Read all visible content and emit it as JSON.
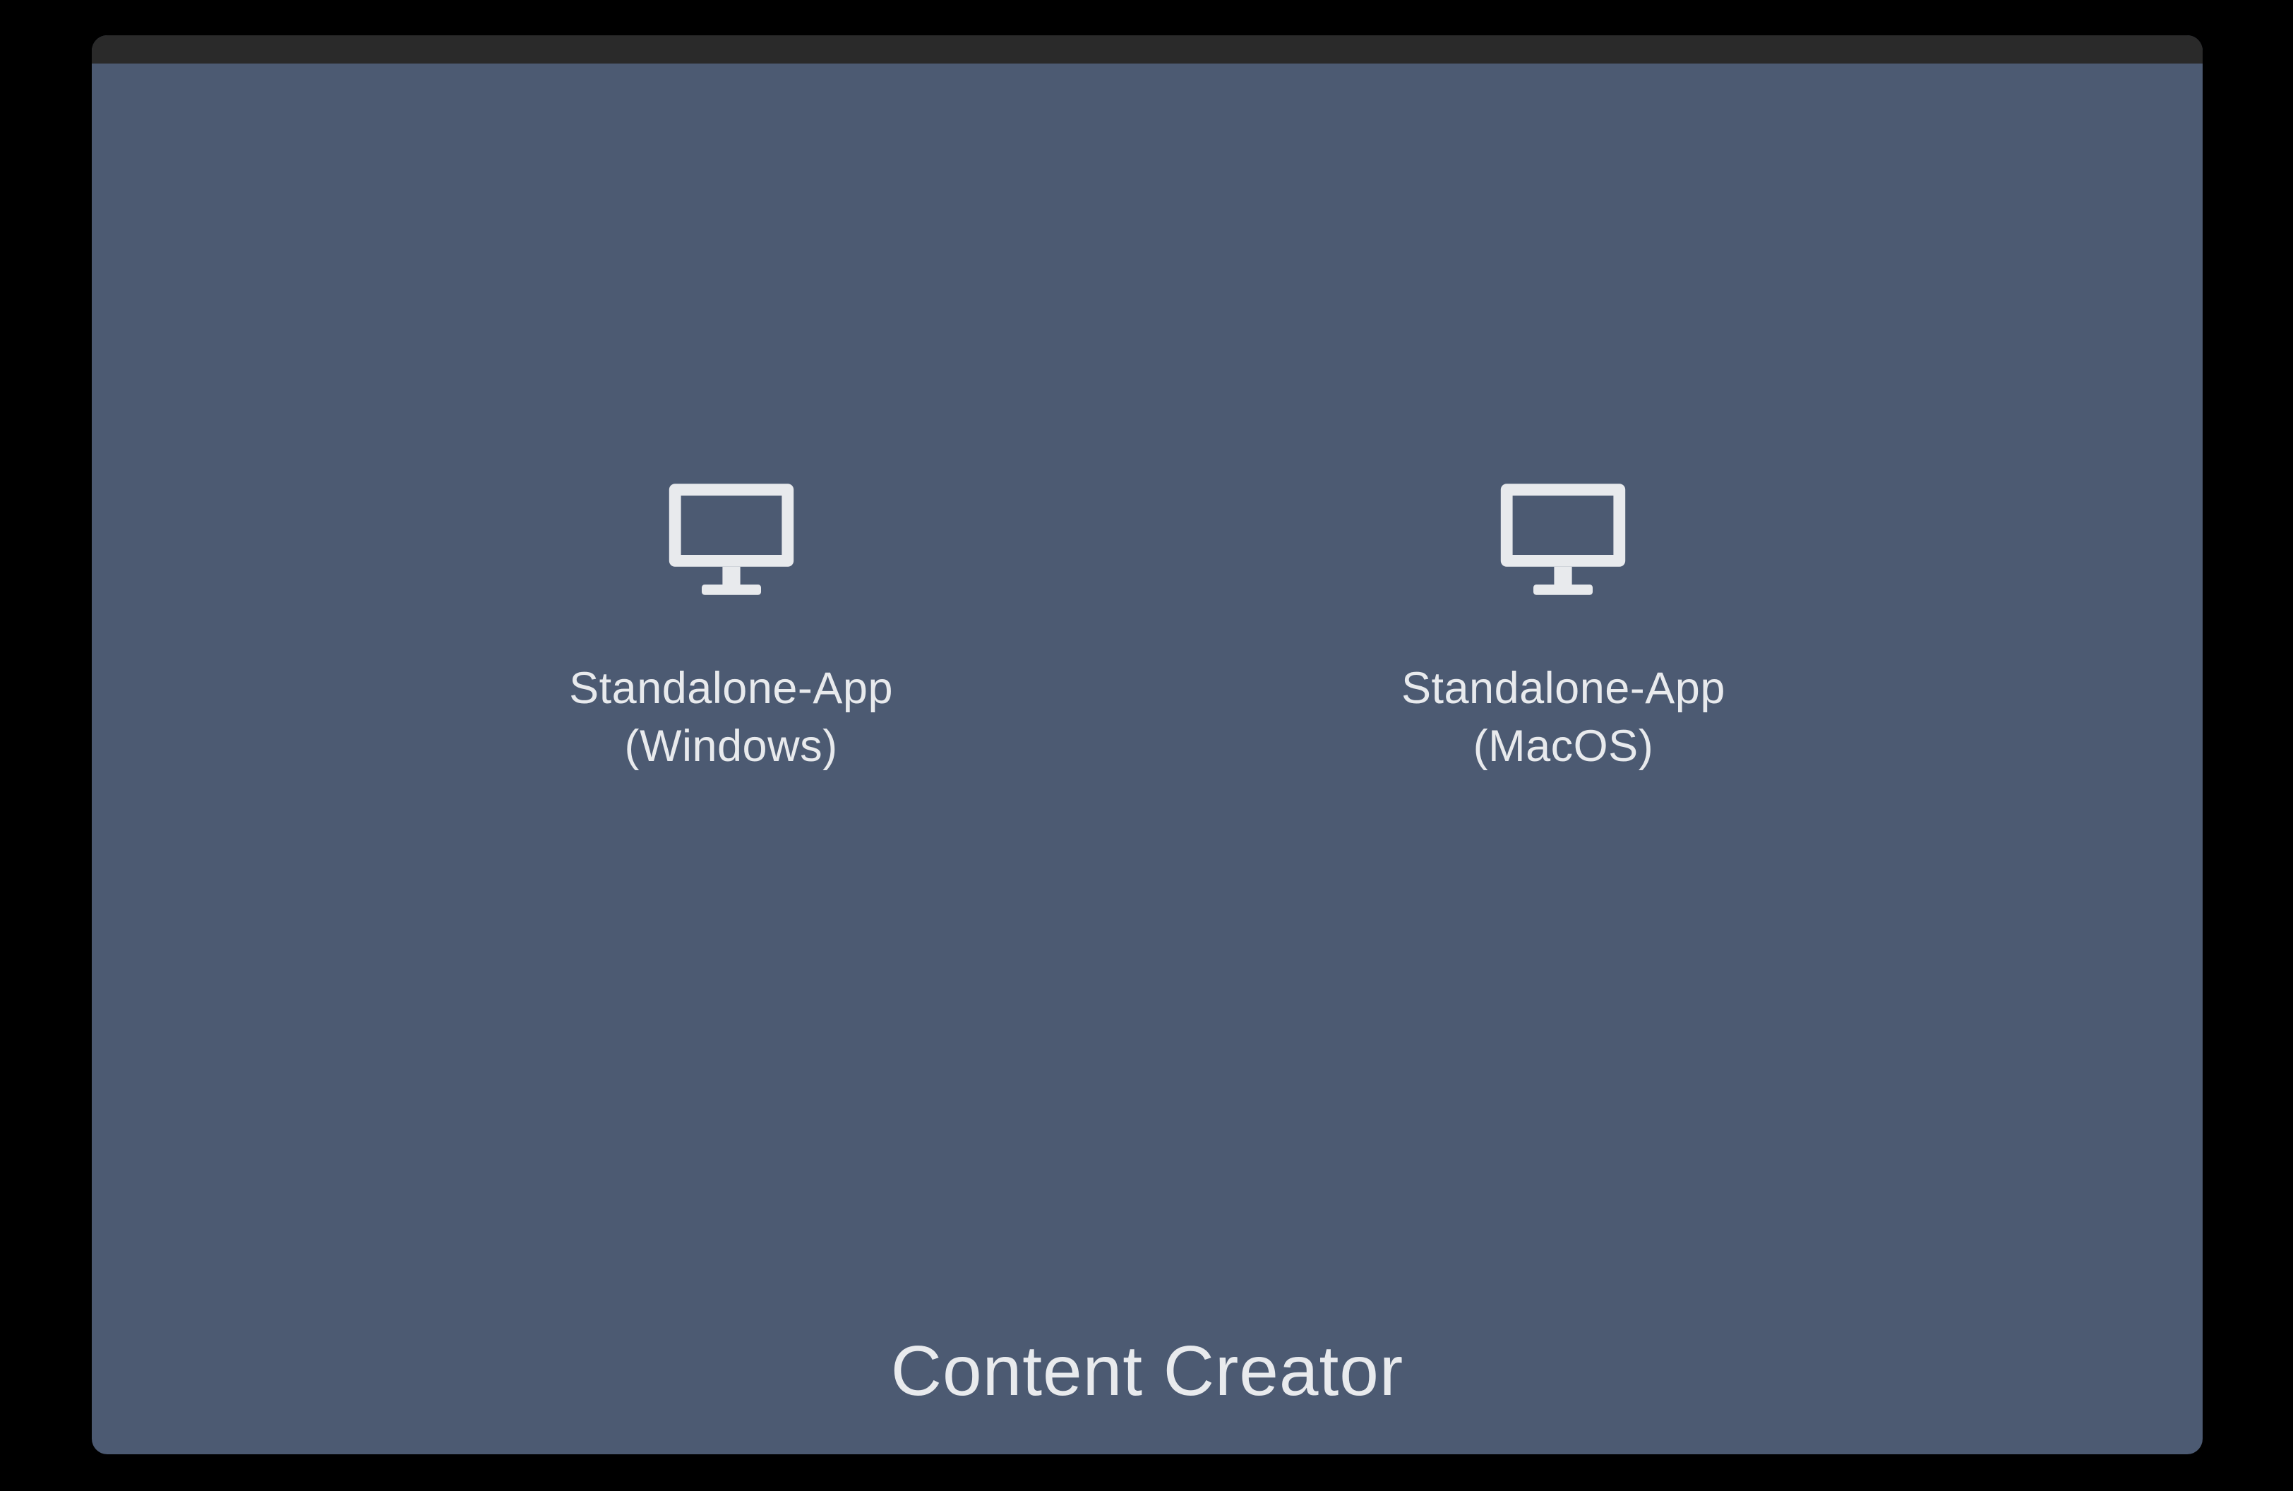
{
  "page": {
    "title": "Content Creator"
  },
  "options": [
    {
      "label": "Standalone-App\n(Windows)",
      "icon": "desktop"
    },
    {
      "label": "Standalone-App\n(MacOS)",
      "icon": "desktop"
    }
  ]
}
